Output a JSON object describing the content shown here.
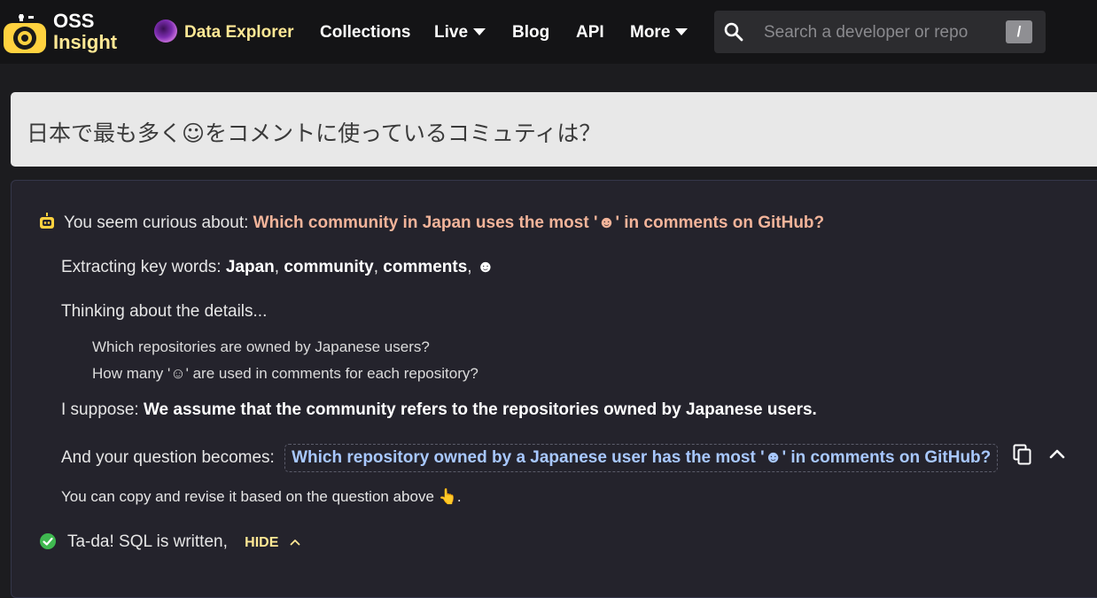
{
  "header": {
    "logo_line1": "OSS",
    "logo_line2": "Insight",
    "nav": {
      "explorer": "Data Explorer",
      "collections": "Collections",
      "live": "Live",
      "blog": "Blog",
      "api": "API",
      "more": "More"
    },
    "search": {
      "placeholder": "Search a developer or repo",
      "shortcut": "/"
    }
  },
  "question": {
    "text": "日本で最も多く☺をコメントに使っているコミュティは？"
  },
  "answer": {
    "curious_prefix": "You seem curious about:",
    "curious_question": "Which community in Japan uses the most '☻' in comments on GitHub?",
    "keywords_prefix": "Extracting key words:",
    "keywords": [
      "Japan",
      "community",
      "comments",
      "☻"
    ],
    "thinking_label": "Thinking about the details...",
    "details": [
      "Which repositories are owned by Japanese users?",
      "How many '☺' are used in comments for each repository?"
    ],
    "suppose_prefix": "I suppose:",
    "suppose_text": "We assume that the community refers to the repositories owned by Japanese users.",
    "becomes_prefix": "And your question becomes:",
    "revised_question": "Which repository owned by a Japanese user has the most '☻' in comments on GitHub?",
    "copy_hint": "You can copy and revise it based on the question above",
    "copy_hint_emoji": "👆",
    "sql_status": "Ta-da! SQL is written,",
    "hide_label": "HIDE"
  },
  "colors": {
    "accent": "#f2b49a",
    "brand_yellow": "#ffe895",
    "link_blue": "#a8c8ff",
    "success": "#3fb950"
  }
}
